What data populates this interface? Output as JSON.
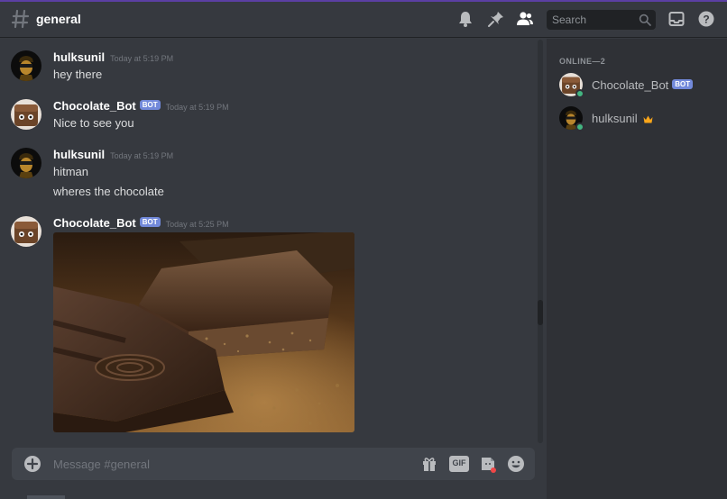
{
  "header": {
    "channel_name": "general",
    "search_placeholder": "Search",
    "icons": [
      "bell-icon",
      "pin-icon",
      "members-icon",
      "search-icon",
      "inbox-icon",
      "help-icon"
    ]
  },
  "messages": [
    {
      "author": "hulksunil",
      "timestamp": "Today at 5:19 PM",
      "lines": [
        "hey there"
      ]
    },
    {
      "author": "Chocolate_Bot",
      "bot_tag": "BOT",
      "timestamp": "Today at 5:19 PM",
      "lines": [
        "Nice to see you"
      ]
    },
    {
      "author": "hulksunil",
      "timestamp": "Today at 5:19 PM",
      "lines": [
        "hitman",
        "wheres the chocolate"
      ]
    },
    {
      "author": "Chocolate_Bot",
      "bot_tag": "BOT",
      "timestamp": "Today at 5:25 PM",
      "attachment": "chocolate-image"
    }
  ],
  "composer": {
    "placeholder": "Message #general",
    "gif_label": "GIF"
  },
  "members": {
    "section_title": "ONLINE—2",
    "list": [
      {
        "name": "Chocolate_Bot",
        "bot_tag": "BOT",
        "status": "online"
      },
      {
        "name": "hulksunil",
        "badge": "crown-icon",
        "status": "online"
      }
    ]
  },
  "colors": {
    "background": "#36393f",
    "sidebar": "#2f3136",
    "blurple": "#7289da",
    "online": "#43b581",
    "crown": "#faa61a"
  }
}
